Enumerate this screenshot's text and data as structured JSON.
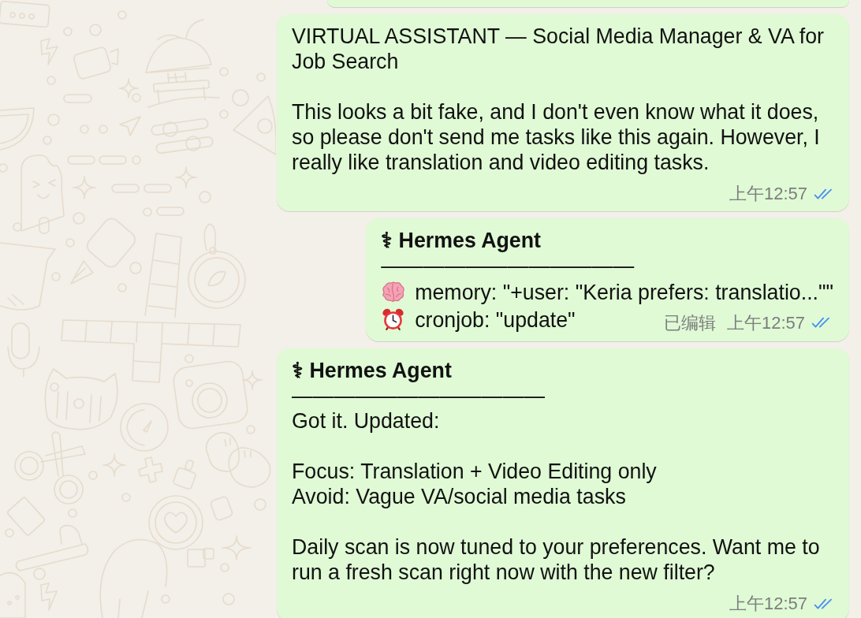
{
  "chat": {
    "messages": [
      {
        "kind": "clipped"
      },
      {
        "kind": "message",
        "blocks": [
          [
            "VIRTUAL ASSISTANT — Social Media Manager & VA for Job Search"
          ],
          [
            "This looks a bit fake, and I don't even know what it does, so please don't send me tasks like this again. However, I really like translation and video editing tasks."
          ]
        ],
        "time": "上午12:57",
        "read": true
      },
      {
        "kind": "message",
        "sender": "⚕ Hermes Agent",
        "rule": "————————————",
        "tool_calls": [
          {
            "kind": "memory",
            "text": "memory: \"+user: \"Keria prefers: translatio...\"\""
          },
          {
            "kind": "cronjob",
            "text": "cronjob: \"update\""
          }
        ],
        "edited": "已编辑",
        "time": "上午12:57",
        "read": true
      },
      {
        "kind": "message",
        "sender": "⚕ Hermes Agent",
        "rule": "————————————",
        "blocks": [
          [
            "Got it. Updated:"
          ],
          [
            "Focus: Translation + Video Editing only",
            "Avoid: Vague VA/social media tasks"
          ],
          [
            "Daily scan is now tuned to your preferences. Want me to run a fresh scan right now with the new filter?"
          ]
        ],
        "time": "上午12:57",
        "read": true
      }
    ]
  }
}
